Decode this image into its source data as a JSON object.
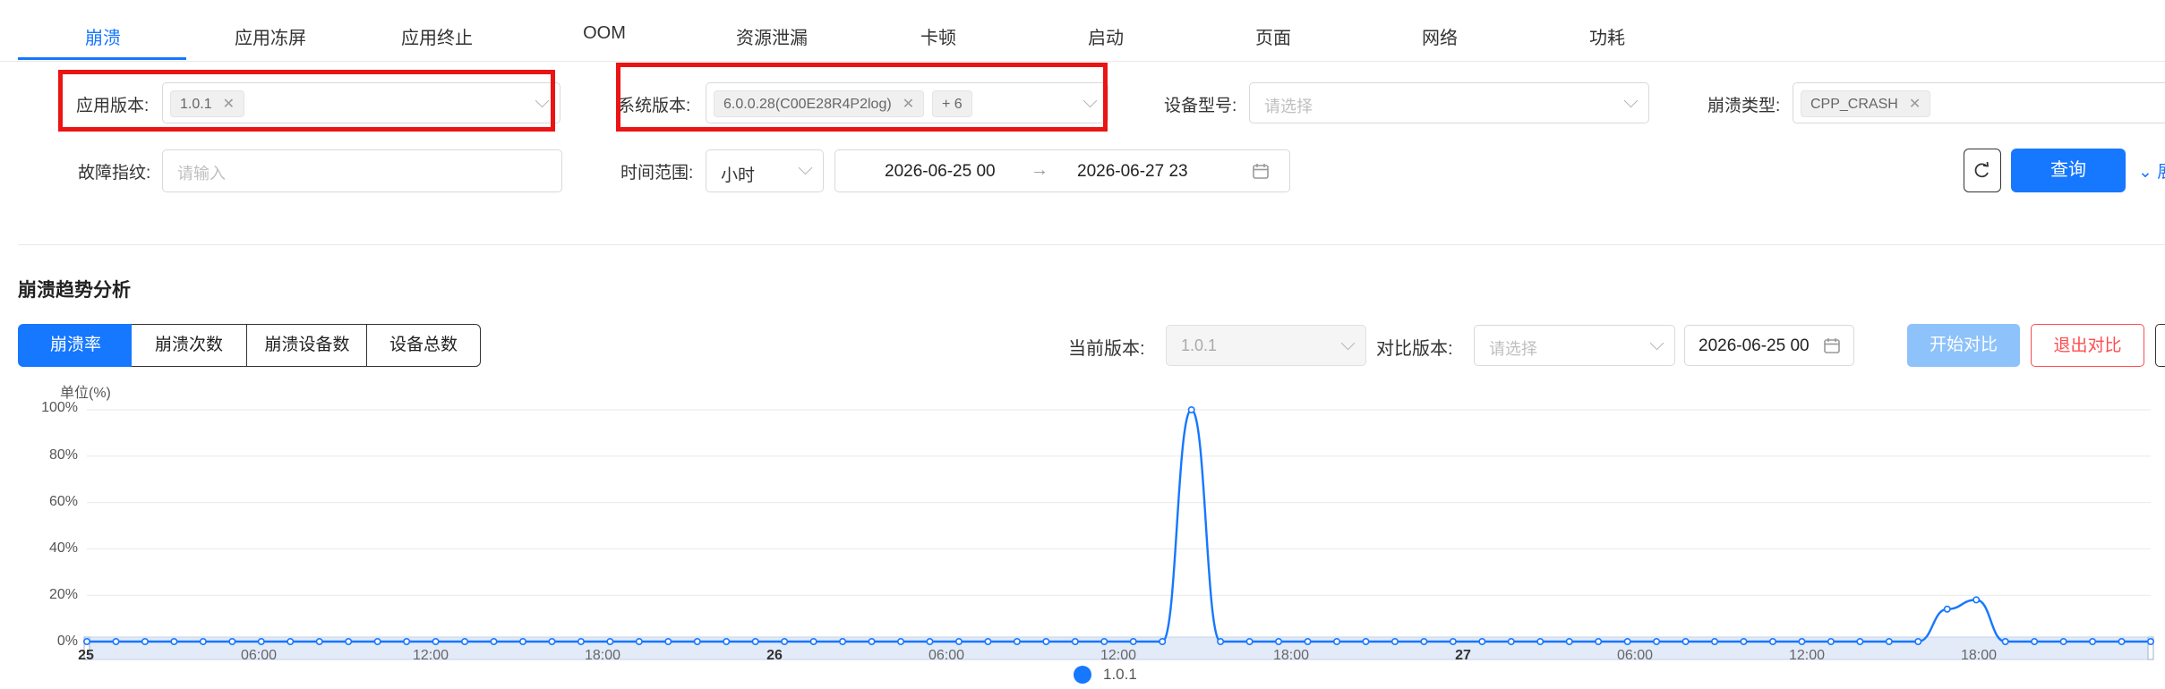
{
  "tabs": [
    "崩溃",
    "应用冻屏",
    "应用终止",
    "OOM",
    "资源泄漏",
    "卡顿",
    "启动",
    "页面",
    "网络",
    "功耗"
  ],
  "filters": {
    "app_version": {
      "label": "应用版本:",
      "tag": "1.0.1"
    },
    "os_version": {
      "label": "系统版本:",
      "tag": "6.0.0.28(C00E28R4P2log)",
      "more": "+ 6"
    },
    "device_model": {
      "label": "设备型号:",
      "placeholder": "请选择"
    },
    "crash_type": {
      "label": "崩溃类型:",
      "tag": "CPP_CRASH"
    },
    "fingerprint": {
      "label": "故障指纹:",
      "placeholder": "请输入"
    },
    "time_range": {
      "label": "时间范围:",
      "unit": "小时",
      "start": "2026-06-25 00",
      "arrow": "→",
      "end": "2026-06-27 23"
    },
    "query_button": "查询",
    "expand_label": "展"
  },
  "trend": {
    "title": "崩溃趋势分析",
    "metrics": [
      "崩溃率",
      "崩溃次数",
      "崩溃设备数",
      "设备总数"
    ],
    "active_metric": "崩溃率",
    "current_version_label": "当前版本:",
    "current_version_value": "1.0.1",
    "compare_version_label": "对比版本:",
    "compare_version_placeholder": "请选择",
    "compare_date": "2026-06-25 00",
    "start_compare_button": "开始对比",
    "exit_compare_button": "退出对比"
  },
  "chart_data": {
    "type": "line",
    "unit_label": "单位(%)",
    "y_ticks": [
      "100%",
      "80%",
      "60%",
      "40%",
      "20%",
      "0%"
    ],
    "ylim": [
      0,
      100
    ],
    "x_tick_labels": [
      "25",
      "06:00",
      "12:00",
      "18:00",
      "26",
      "06:00",
      "12:00",
      "18:00",
      "27",
      "06:00",
      "12:00",
      "18:00"
    ],
    "x_hours_start": 0,
    "x_hours_end": 71,
    "series": [
      {
        "name": "1.0.1",
        "color": "#1677ff",
        "points": [
          [
            0,
            0
          ],
          [
            1,
            0
          ],
          [
            2,
            0
          ],
          [
            3,
            0
          ],
          [
            4,
            0
          ],
          [
            5,
            0
          ],
          [
            6,
            0
          ],
          [
            7,
            0
          ],
          [
            8,
            0
          ],
          [
            9,
            0
          ],
          [
            10,
            0
          ],
          [
            11,
            0
          ],
          [
            12,
            0
          ],
          [
            13,
            0
          ],
          [
            14,
            0
          ],
          [
            15,
            0
          ],
          [
            16,
            0
          ],
          [
            17,
            0
          ],
          [
            18,
            0
          ],
          [
            19,
            0
          ],
          [
            20,
            0
          ],
          [
            21,
            0
          ],
          [
            22,
            0
          ],
          [
            23,
            0
          ],
          [
            24,
            0
          ],
          [
            25,
            0
          ],
          [
            26,
            0
          ],
          [
            27,
            0
          ],
          [
            28,
            0
          ],
          [
            29,
            0
          ],
          [
            30,
            0
          ],
          [
            31,
            0
          ],
          [
            32,
            0
          ],
          [
            33,
            0
          ],
          [
            34,
            0
          ],
          [
            35,
            0
          ],
          [
            36,
            0
          ],
          [
            37,
            0
          ],
          [
            38,
            100
          ],
          [
            39,
            0
          ],
          [
            40,
            0
          ],
          [
            41,
            0
          ],
          [
            42,
            0
          ],
          [
            43,
            0
          ],
          [
            44,
            0
          ],
          [
            45,
            0
          ],
          [
            46,
            0
          ],
          [
            47,
            0
          ],
          [
            48,
            0
          ],
          [
            49,
            0
          ],
          [
            50,
            0
          ],
          [
            51,
            0
          ],
          [
            52,
            0
          ],
          [
            53,
            0
          ],
          [
            54,
            0
          ],
          [
            55,
            0
          ],
          [
            56,
            0
          ],
          [
            57,
            0
          ],
          [
            58,
            0
          ],
          [
            59,
            0
          ],
          [
            60,
            0
          ],
          [
            61,
            0
          ],
          [
            62,
            0
          ],
          [
            63,
            0
          ],
          [
            64,
            14
          ],
          [
            65,
            18
          ],
          [
            66,
            0
          ],
          [
            67,
            0
          ],
          [
            68,
            0
          ],
          [
            69,
            0
          ],
          [
            70,
            0
          ],
          [
            71,
            0
          ]
        ]
      }
    ],
    "legend": [
      "1.0.1"
    ]
  }
}
